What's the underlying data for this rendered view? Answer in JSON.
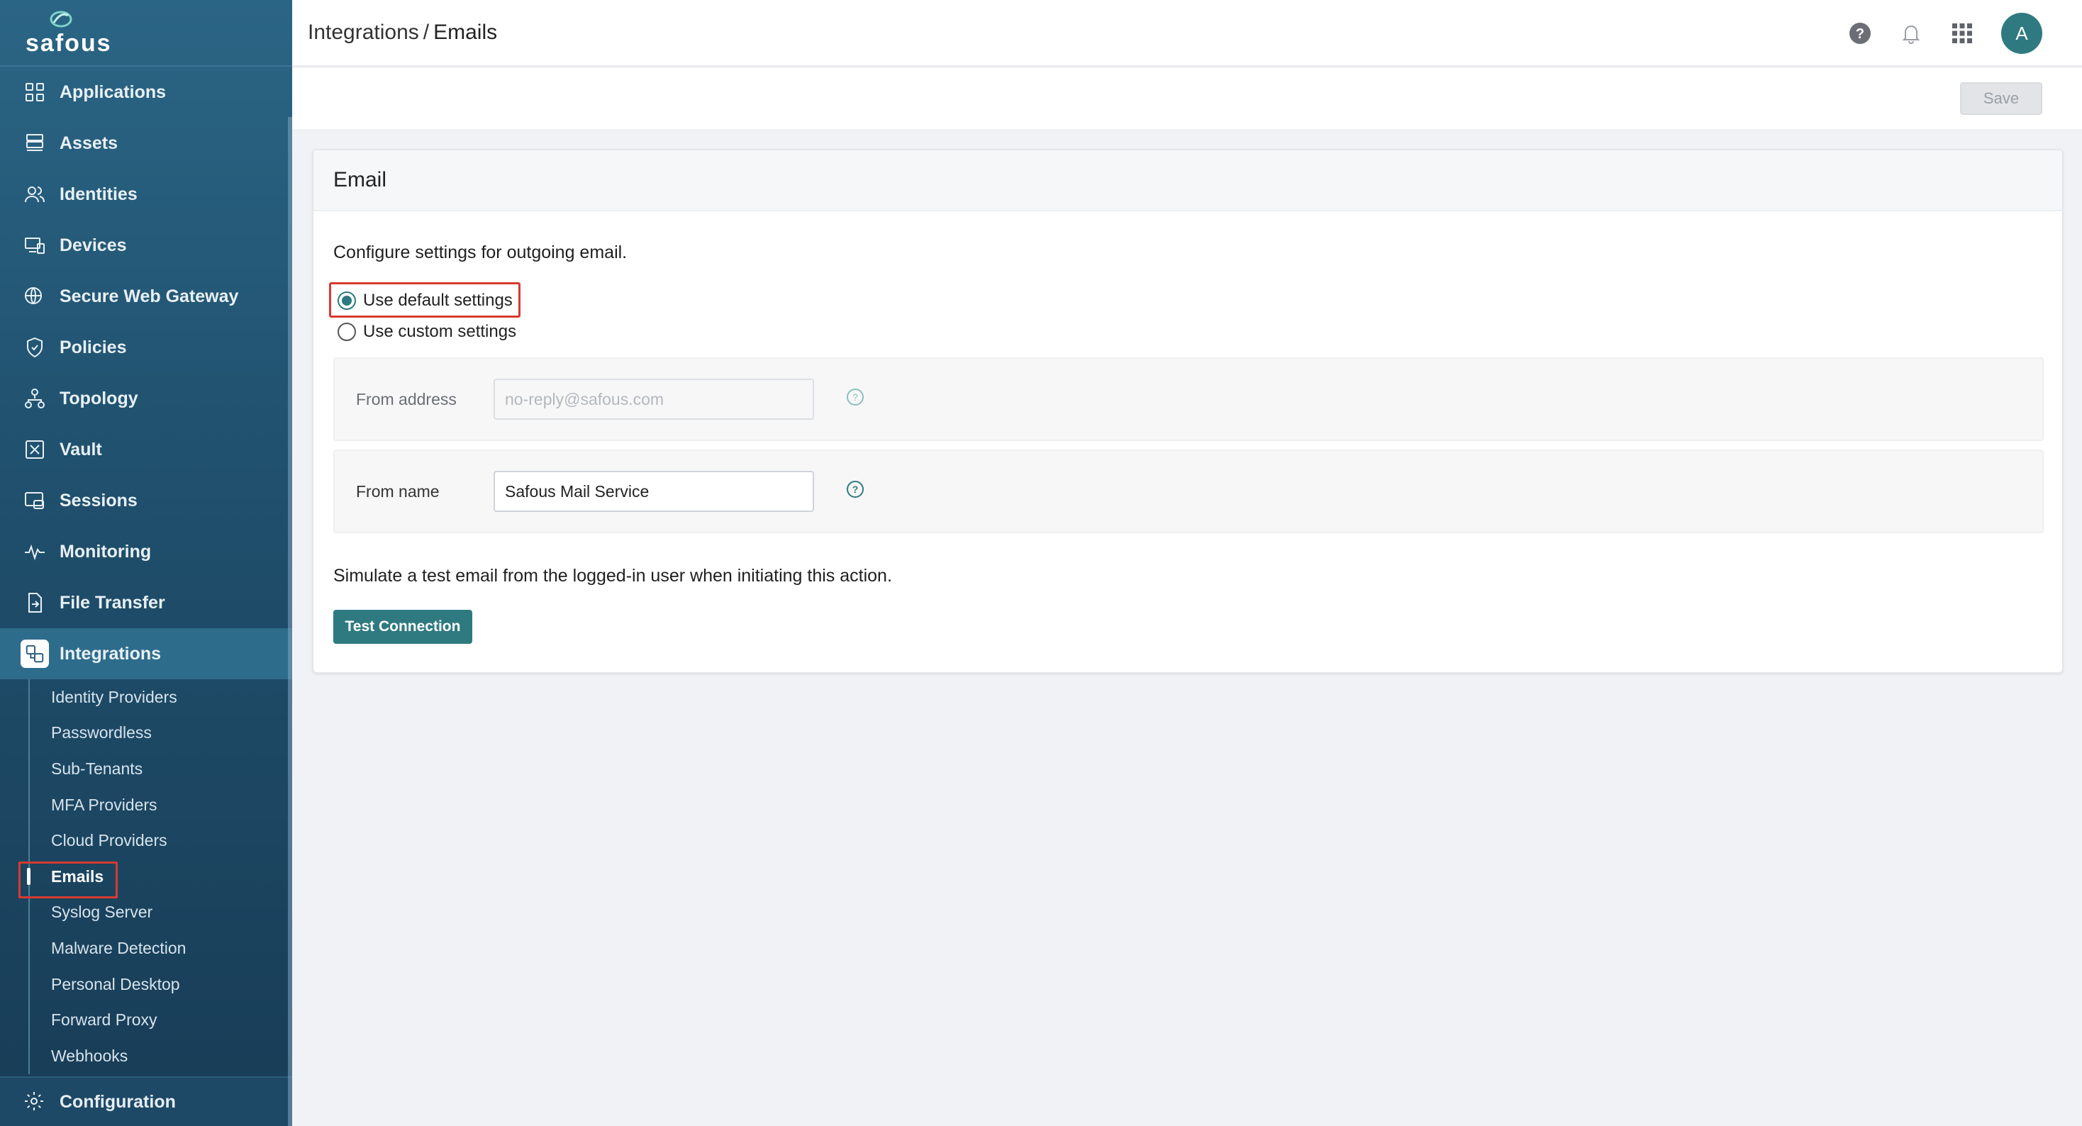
{
  "brand": {
    "name": "safous"
  },
  "sidebar": {
    "items": [
      {
        "label": "Applications",
        "icon": "grid-icon"
      },
      {
        "label": "Assets",
        "icon": "server-icon"
      },
      {
        "label": "Identities",
        "icon": "users-icon"
      },
      {
        "label": "Devices",
        "icon": "devices-icon"
      },
      {
        "label": "Secure Web Gateway",
        "icon": "globe-shield-icon"
      },
      {
        "label": "Policies",
        "icon": "shield-icon"
      },
      {
        "label": "Topology",
        "icon": "topology-icon"
      },
      {
        "label": "Vault",
        "icon": "vault-icon"
      },
      {
        "label": "Sessions",
        "icon": "sessions-icon"
      },
      {
        "label": "Monitoring",
        "icon": "pulse-icon"
      },
      {
        "label": "File Transfer",
        "icon": "file-transfer-icon"
      },
      {
        "label": "Integrations",
        "icon": "integrations-icon",
        "active": true
      }
    ],
    "sub_items": [
      {
        "label": "Identity Providers"
      },
      {
        "label": "Passwordless"
      },
      {
        "label": "Sub-Tenants"
      },
      {
        "label": "MFA Providers"
      },
      {
        "label": "Cloud Providers"
      },
      {
        "label": "Emails",
        "active": true
      },
      {
        "label": "Syslog Server"
      },
      {
        "label": "Malware Detection"
      },
      {
        "label": "Personal Desktop"
      },
      {
        "label": "Forward Proxy"
      },
      {
        "label": "Webhooks"
      }
    ],
    "config_label": "Configuration"
  },
  "header": {
    "breadcrumb_parent": "Integrations",
    "breadcrumb_sep": "/",
    "breadcrumb_current": "Emails",
    "avatar_initial": "A"
  },
  "toolbar": {
    "save_label": "Save"
  },
  "card": {
    "title": "Email",
    "description": "Configure settings for outgoing email.",
    "radio_default": "Use default settings",
    "radio_custom": "Use custom settings",
    "selected": "default",
    "from_address_label": "From address",
    "from_address_placeholder": "no-reply@safous.com",
    "from_name_label": "From name",
    "from_name_value": "Safous Mail Service",
    "test_text": "Simulate a test email from the logged-in user when initiating this action.",
    "test_button": "Test Connection"
  },
  "colors": {
    "accent": "#2f7a80",
    "highlight": "#d63b2f",
    "sidebar": "#1f4f6c"
  }
}
